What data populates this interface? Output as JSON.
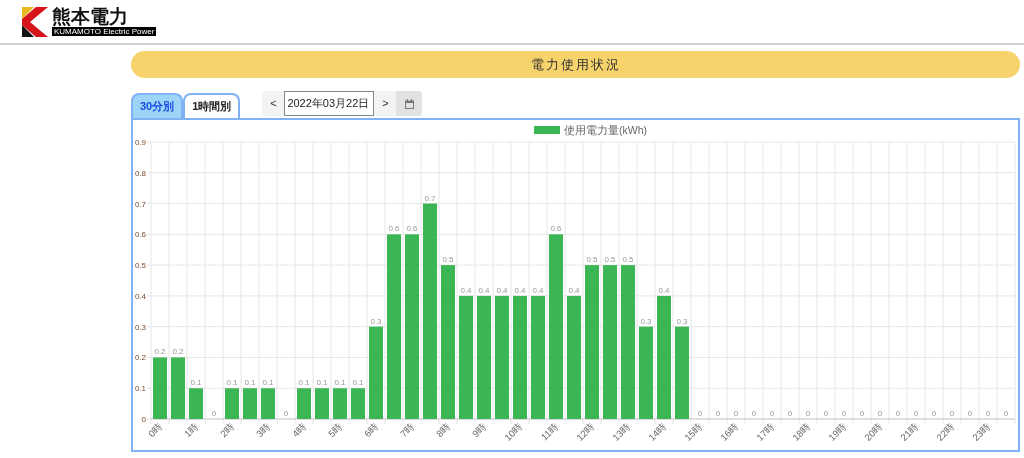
{
  "logo": {
    "name": "熊本電力",
    "subtitle": "KUMAMOTO Electric Power"
  },
  "title": "電力使用状況",
  "tabs": [
    {
      "label": "30分別",
      "selected": true
    },
    {
      "label": "1時間別",
      "selected": false
    }
  ],
  "date_nav": {
    "prev": "<",
    "value": "2022年03月22日",
    "next": ">"
  },
  "chart": {
    "chart_data": {
      "type": "bar",
      "data_labels": true,
      "grid": true,
      "xlim": [
        0,
        24
      ],
      "ylim": [
        0,
        0.9
      ],
      "yticks": [
        0,
        0.1,
        0.2,
        0.3,
        0.4,
        0.5,
        0.6,
        0.7,
        0.8,
        0.9
      ],
      "x": [
        0.25,
        0.75,
        1.25,
        1.75,
        2.25,
        2.75,
        3.25,
        3.75,
        4.25,
        4.75,
        5.25,
        5.75,
        6.25,
        6.75,
        7.25,
        7.75,
        8.25,
        8.75,
        9.25,
        9.75,
        10.25,
        10.75,
        11.25,
        11.75,
        12.25,
        12.75,
        13.25,
        13.75,
        14.25,
        14.75,
        15.25,
        15.75,
        16.25,
        16.75,
        17.25,
        17.75,
        18.25,
        18.75,
        19.25,
        19.75,
        20.25,
        20.75,
        21.25,
        21.75,
        22.25,
        22.75,
        23.25,
        23.75
      ],
      "xticks": [
        {
          "value": 0,
          "label": "0時"
        },
        {
          "value": 1,
          "label": "1時"
        },
        {
          "value": 2,
          "label": "2時"
        },
        {
          "value": 3,
          "label": "3時"
        },
        {
          "value": 4,
          "label": "4時"
        },
        {
          "value": 5,
          "label": "5時"
        },
        {
          "value": 6,
          "label": "6時"
        },
        {
          "value": 7,
          "label": "7時"
        },
        {
          "value": 8,
          "label": "8時"
        },
        {
          "value": 9,
          "label": "9時"
        },
        {
          "value": 10,
          "label": "10時"
        },
        {
          "value": 11,
          "label": "11時"
        },
        {
          "value": 12,
          "label": "12時"
        },
        {
          "value": 13,
          "label": "13時"
        },
        {
          "value": 14,
          "label": "14時"
        },
        {
          "value": 15,
          "label": "15時"
        },
        {
          "value": 16,
          "label": "16時"
        },
        {
          "value": 17,
          "label": "17時"
        },
        {
          "value": 18,
          "label": "18時"
        },
        {
          "value": 19,
          "label": "19時"
        },
        {
          "value": 20,
          "label": "20時"
        },
        {
          "value": 21,
          "label": "21時"
        },
        {
          "value": 22,
          "label": "22時"
        },
        {
          "value": 23,
          "label": "23時"
        }
      ],
      "series": [
        {
          "name": "使用電力量(kWh)",
          "color": "#3cb554",
          "values": [
            0.2,
            0.2,
            0.1,
            0,
            0.1,
            0.1,
            0.1,
            0,
            0.1,
            0.1,
            0.1,
            0.1,
            0.3,
            0.6,
            0.6,
            0.7,
            0.5,
            0.4,
            0.4,
            0.4,
            0.4,
            0.4,
            0.6,
            0.4,
            0.5,
            0.5,
            0.5,
            0.3,
            0.4,
            0.3,
            0,
            0,
            0,
            0,
            0,
            0,
            0,
            0,
            0,
            0,
            0,
            0,
            0,
            0,
            0,
            0,
            0,
            0
          ]
        }
      ]
    }
  }
}
